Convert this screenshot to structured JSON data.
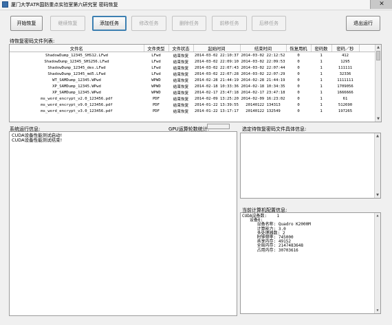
{
  "window": {
    "title": "厦门大学ATR国防重点实验室第六研究室 密码恢复",
    "close_symbol": "✕"
  },
  "toolbar": {
    "start": "开始恢复",
    "continue": "继续恢复",
    "add": "添加任务",
    "modify": "修改任务",
    "delete": "删除任务",
    "move_forward": "前移任务",
    "move_back": "后移任务",
    "exit": "退出运行"
  },
  "file_list": {
    "label": "待恢复密码文件列表:",
    "columns": [
      "文件名",
      "文件类型",
      "文件状态",
      "起始时间",
      "结束时间",
      "恢复用机",
      "密码数",
      "密码／秒"
    ],
    "rows": [
      [
        "ShadowDump_12345_SHS12.LFwd",
        "LFwd",
        "结束恢复",
        "2014-03-02 22:10:37",
        "2014-03-02 22:12:52",
        "0",
        "1",
        "412"
      ],
      [
        "ShadowDump_12345_SHS256.LFwd",
        "LFwd",
        "结束恢复",
        "2014-03-02 22:09:10",
        "2014-03-02 22:09:53",
        "0",
        "1",
        "1295"
      ],
      [
        "ShadowDump_12345_des.LFwd",
        "LFwd",
        "结束恢复",
        "2014-03-02 22:07:43",
        "2014-03-02 22:07:44",
        "0",
        "1",
        "111111"
      ],
      [
        "ShadowDump_12345_md5.LFwd",
        "LFwd",
        "结束恢复",
        "2014-03-02 22:07:28",
        "2014-03-02 22:07:29",
        "0",
        "1",
        "32336"
      ],
      [
        "WT_SAMDump_12345.WPwd",
        "WPWD",
        "结束恢复",
        "2014-02-28 21:44:19",
        "2014-02-28 21:44:19",
        "0",
        "1",
        "1111111"
      ],
      [
        "XP_SAMDump_12345.WPwd",
        "WPWD",
        "结束恢复",
        "2014-02-18 10:33:36",
        "2014-02-18 10:34:35",
        "0",
        "1",
        "1709056"
      ],
      [
        "XP_SAMDump_12345.WPwd",
        "WPWD",
        "结束恢复",
        "2014-02-17 23:47:18",
        "2014-02-17 23:47:18",
        "0",
        "1",
        "1666666"
      ],
      [
        "ms_word_encrypt_v2.0_123456.pdf",
        "PDF",
        "结束恢复",
        "2014-02-09 13:25:20",
        "2014-02-09 16:23:02",
        "0",
        "1",
        "61"
      ],
      [
        "ms_word_encrypt_v9.0_123456.pdf",
        "PDF",
        "结束恢复",
        "2014-01-22 13:39:55",
        "20140122 134313",
        "0",
        "1",
        "512690"
      ],
      [
        "ms_word_encrypt_v3.0_123456.pdf",
        "PDF",
        "结束恢复",
        "2014-01-22 13:17:17",
        "20140122 132549",
        "0",
        "1",
        "197265"
      ]
    ]
  },
  "system_info": {
    "label": "系统运行信息:",
    "lines": [
      "CUDA设备性能测试启动!",
      "CUDA设备性能测试结束!"
    ]
  },
  "gpu_stats": {
    "label": "GPU运算轮数统计:"
  },
  "selected_file": {
    "label": "选定待恢复密码文件具体信息:"
  },
  "compute_config": {
    "label": "当前计算机配置信息:",
    "lines": [
      "CUDA设备数:    1",
      "   设备0:",
      "      设备名称: Quadro K2000M",
      "      计算能力: 3.0",
      "      多处理器数: 2",
      "      时钟频率: 745000",
      "      共享内存: 49152",
      "      全局内存: 2147483648",
      "      占用内存: 30703616"
    ]
  }
}
